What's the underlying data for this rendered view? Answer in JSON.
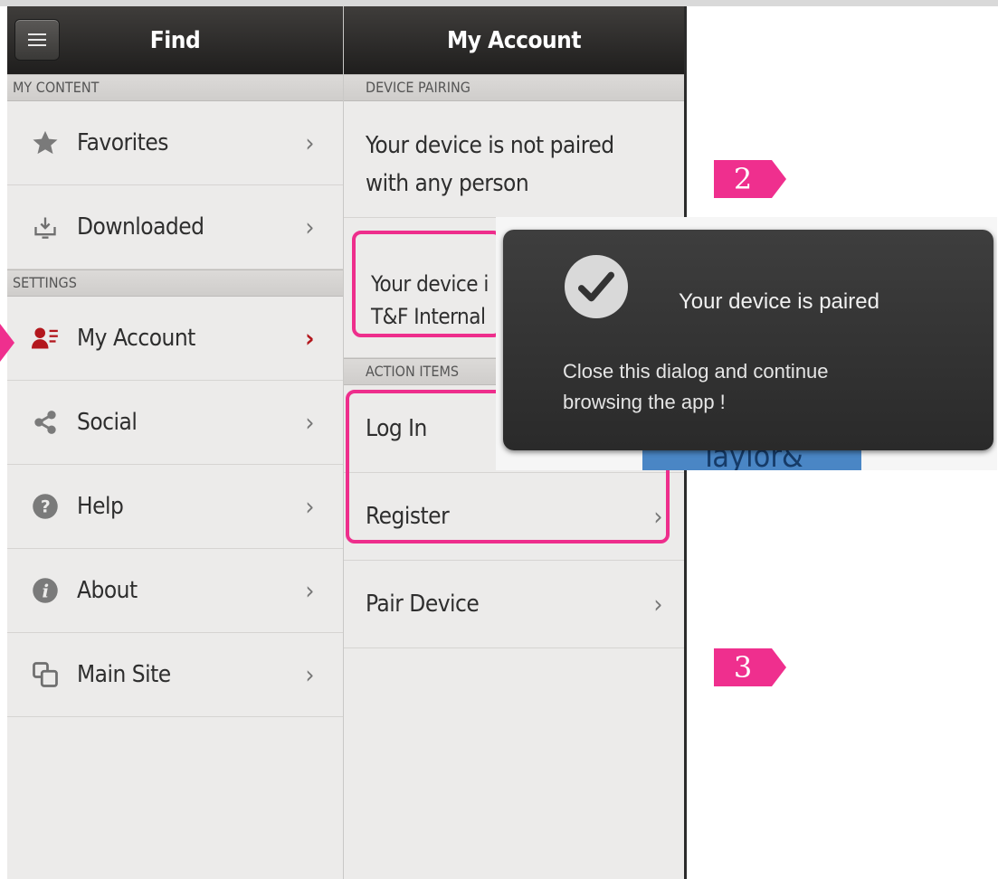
{
  "left_panel": {
    "title": "Find",
    "sections": {
      "my_content": "MY CONTENT",
      "settings": "SETTINGS"
    },
    "items": [
      {
        "label": "Favorites",
        "icon": "star-icon"
      },
      {
        "label": "Downloaded",
        "icon": "download-icon"
      },
      {
        "label": "My Account",
        "icon": "account-icon",
        "active": true
      },
      {
        "label": "Social",
        "icon": "share-icon"
      },
      {
        "label": "Help",
        "icon": "help-icon"
      },
      {
        "label": "About",
        "icon": "info-icon"
      },
      {
        "label": "Main Site",
        "icon": "external-site-icon"
      }
    ],
    "chevron": "›"
  },
  "right_panel": {
    "title": "My Account",
    "sections": {
      "device_pairing": "DEVICE PAIRING",
      "action_items": "ACTION ITEMS"
    },
    "pairing_message_line1": "Your device is not paired",
    "pairing_message_line2": "with any person",
    "paired_line1": "Your device i",
    "paired_line2": "T&F Internal",
    "actions": [
      "Log In",
      "Register",
      "Pair Device"
    ]
  },
  "popup": {
    "title": "Your device is paired",
    "body_line1": "Close this dialog and continue",
    "body_line2": "browsing the app !",
    "background_fragment": "Taylor&"
  },
  "step_markers": [
    "2",
    "3"
  ],
  "colors": {
    "accent_pink": "#ee2e8c",
    "active_red": "#b3171d",
    "header_dark": "#2a2928"
  }
}
